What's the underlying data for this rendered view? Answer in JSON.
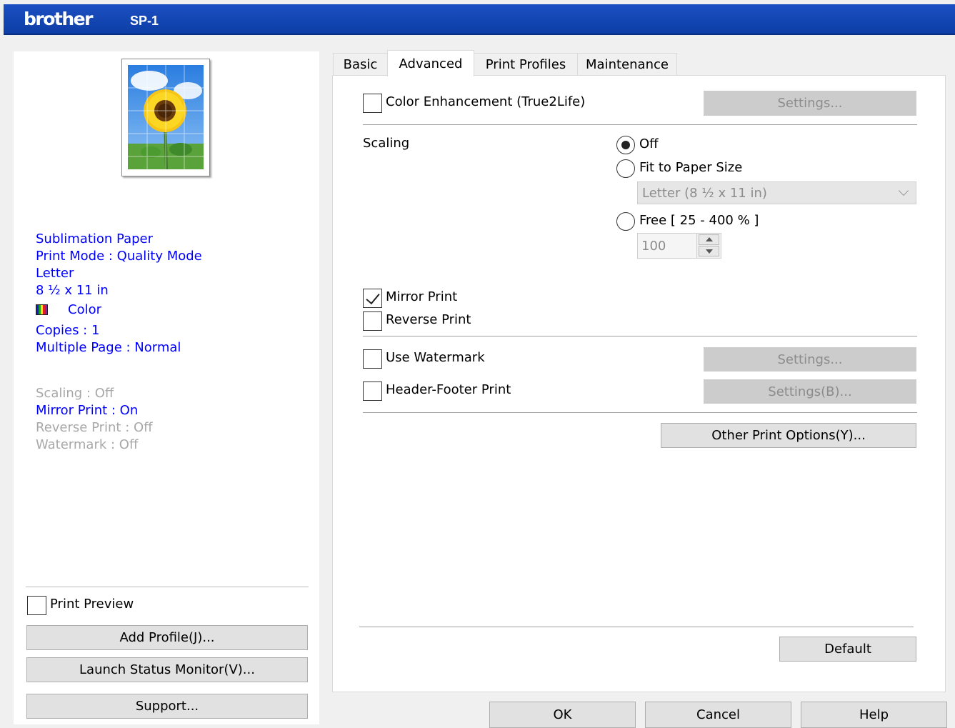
{
  "header": {
    "brand": "brother",
    "model": "SP-1"
  },
  "left_panel": {
    "info": {
      "media": "Sublimation Paper",
      "print_mode": "Print Mode : Quality Mode",
      "paper": "Letter",
      "paper_dims": "8 ½ x 11 in",
      "color": "Color",
      "copies": "Copies : 1",
      "multiple_page": "Multiple Page : Normal",
      "scaling": "Scaling : Off",
      "mirror_print": "Mirror Print : On",
      "reverse_print": "Reverse Print : Off",
      "watermark": "Watermark : Off"
    },
    "print_preview_label": "Print Preview",
    "add_profile_label": "Add Profile(J)...",
    "launch_status_label": "Launch Status Monitor(V)...",
    "support_label": "Support..."
  },
  "tabs": [
    "Basic",
    "Advanced",
    "Print Profiles",
    "Maintenance"
  ],
  "advanced": {
    "color_enhancement_label": "Color Enhancement (True2Life)",
    "color_settings_label": "Settings...",
    "scaling_label": "Scaling",
    "scaling_off_label": "Off",
    "fit_to_paper_label": "Fit to Paper Size",
    "paper_size_value": "Letter (8 ½ x 11 in)",
    "free_label": "Free [ 25 - 400 % ]",
    "free_value": "100",
    "mirror_print_label": "Mirror Print",
    "reverse_print_label": "Reverse Print",
    "use_watermark_label": "Use Watermark",
    "watermark_settings_label": "Settings...",
    "header_footer_label": "Header-Footer Print",
    "header_footer_settings_label": "Settings(B)...",
    "other_options_label": "Other Print Options(Y)...",
    "default_label": "Default"
  },
  "dialog_buttons": {
    "ok": "OK",
    "cancel": "Cancel",
    "help": "Help"
  },
  "state": {
    "active_tab": "Advanced",
    "scaling": "Off",
    "mirror_print": true,
    "reverse_print": false,
    "color_enhancement": false,
    "use_watermark": false,
    "header_footer": false,
    "print_preview": false
  },
  "colors": {
    "header": "#1c4fc2",
    "info_text": "#0000ff",
    "disabled_text": "#a8a8a8"
  }
}
